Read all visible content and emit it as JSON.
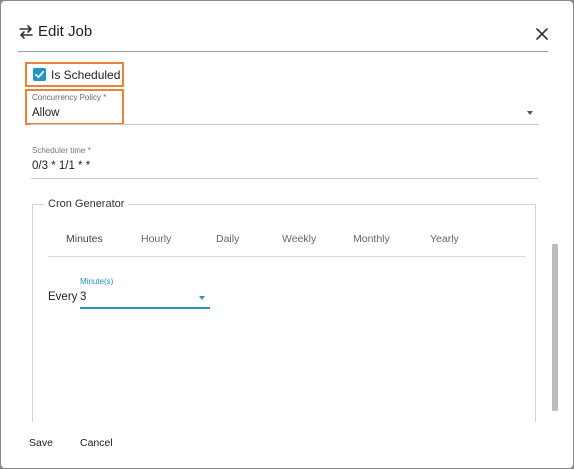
{
  "header": {
    "title": "Edit Job",
    "title_icon": "swap-arrows-icon",
    "close_icon": "close-icon"
  },
  "form": {
    "is_scheduled": {
      "label": "Is Scheduled",
      "checked": true
    },
    "concurrency_policy": {
      "label": "Concurrency Policy *",
      "value": "Allow"
    },
    "scheduler_time": {
      "label": "Scheduler time *",
      "value": "0/3 * 1/1 * *"
    }
  },
  "cron_generator": {
    "legend": "Cron Generator",
    "tabs": [
      {
        "label": "Minutes",
        "active": true
      },
      {
        "label": "Hourly",
        "active": false
      },
      {
        "label": "Daily",
        "active": false
      },
      {
        "label": "Weekly",
        "active": false
      },
      {
        "label": "Monthly",
        "active": false
      },
      {
        "label": "Yearly",
        "active": false
      }
    ],
    "minutes": {
      "prefix": "Every",
      "field_label": "Minute(s)",
      "value": "3"
    }
  },
  "footer": {
    "save_label": "Save",
    "cancel_label": "Cancel"
  },
  "colors": {
    "accent": "#2196c4",
    "highlight_border": "#e8833a"
  }
}
